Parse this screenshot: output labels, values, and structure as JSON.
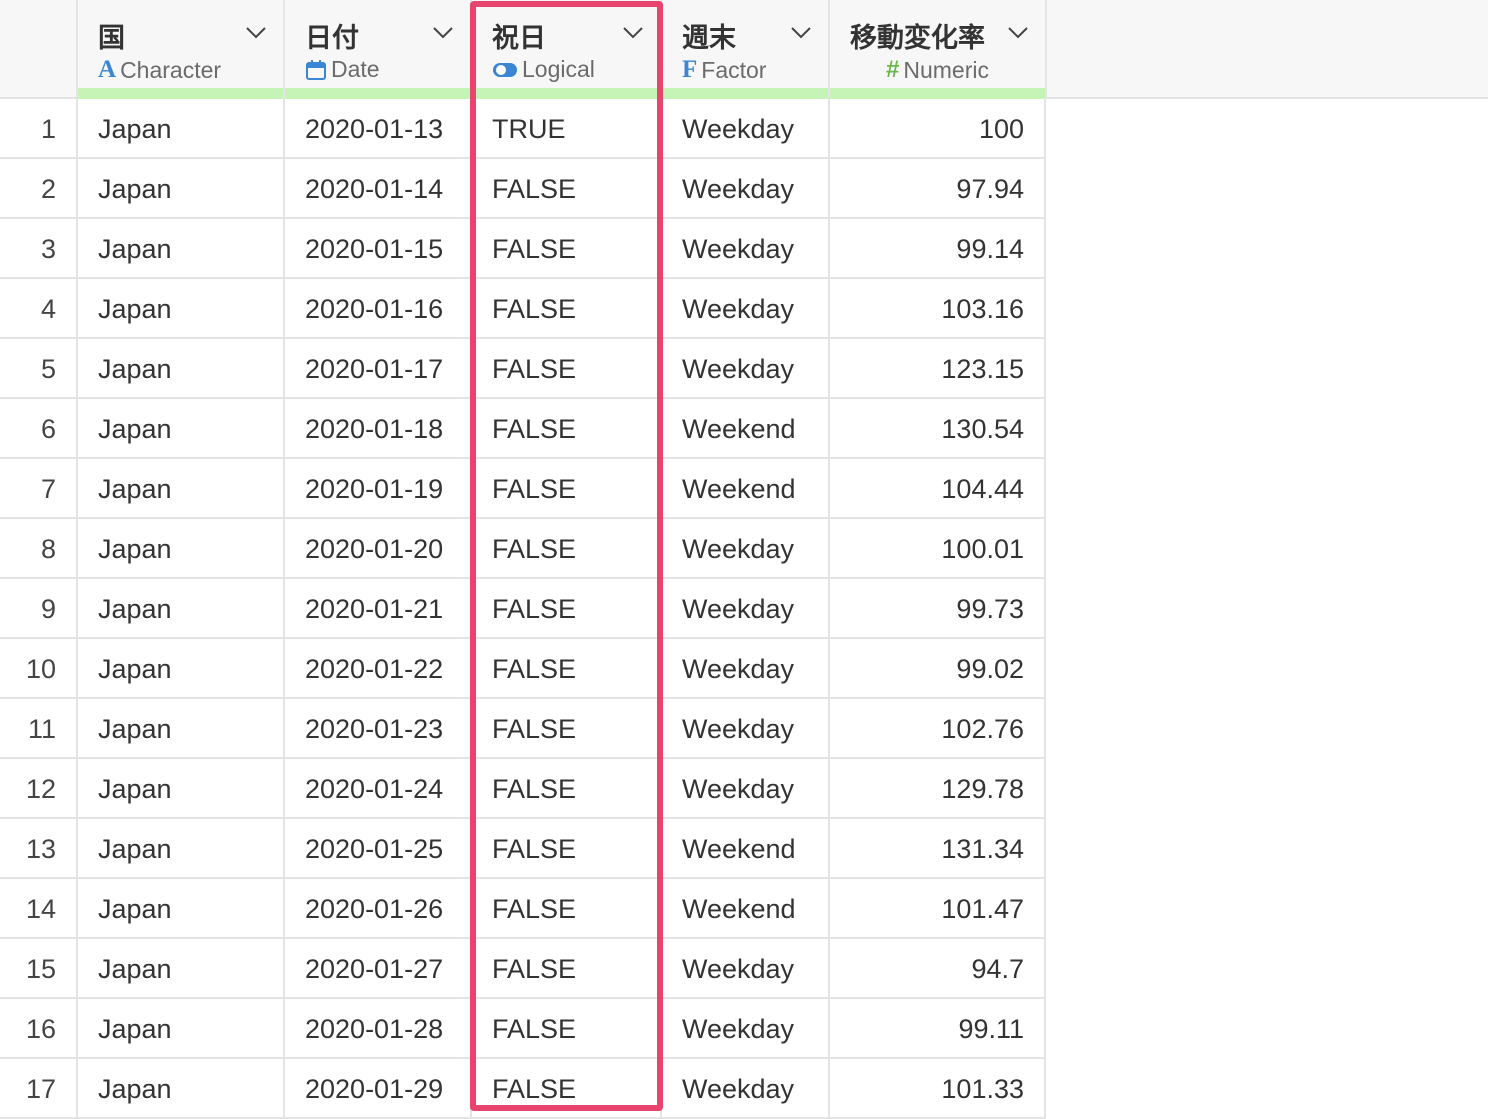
{
  "columns": [
    {
      "name": "国",
      "type_label": "Character",
      "type_icon": "character-type-icon"
    },
    {
      "name": "日付",
      "type_label": "Date",
      "type_icon": "calendar-icon"
    },
    {
      "name": "祝日",
      "type_label": "Logical",
      "type_icon": "toggle-icon"
    },
    {
      "name": "週末",
      "type_label": "Factor",
      "type_icon": "factor-type-icon"
    },
    {
      "name": "移動変化率",
      "type_label": "Numeric",
      "type_icon": "hash-icon"
    }
  ],
  "rows": [
    {
      "idx": "1",
      "country": "Japan",
      "date": "2020-01-13",
      "holiday": "TRUE",
      "weekend": "Weekday",
      "rate": "100"
    },
    {
      "idx": "2",
      "country": "Japan",
      "date": "2020-01-14",
      "holiday": "FALSE",
      "weekend": "Weekday",
      "rate": "97.94"
    },
    {
      "idx": "3",
      "country": "Japan",
      "date": "2020-01-15",
      "holiday": "FALSE",
      "weekend": "Weekday",
      "rate": "99.14"
    },
    {
      "idx": "4",
      "country": "Japan",
      "date": "2020-01-16",
      "holiday": "FALSE",
      "weekend": "Weekday",
      "rate": "103.16"
    },
    {
      "idx": "5",
      "country": "Japan",
      "date": "2020-01-17",
      "holiday": "FALSE",
      "weekend": "Weekday",
      "rate": "123.15"
    },
    {
      "idx": "6",
      "country": "Japan",
      "date": "2020-01-18",
      "holiday": "FALSE",
      "weekend": "Weekend",
      "rate": "130.54"
    },
    {
      "idx": "7",
      "country": "Japan",
      "date": "2020-01-19",
      "holiday": "FALSE",
      "weekend": "Weekend",
      "rate": "104.44"
    },
    {
      "idx": "8",
      "country": "Japan",
      "date": "2020-01-20",
      "holiday": "FALSE",
      "weekend": "Weekday",
      "rate": "100.01"
    },
    {
      "idx": "9",
      "country": "Japan",
      "date": "2020-01-21",
      "holiday": "FALSE",
      "weekend": "Weekday",
      "rate": "99.73"
    },
    {
      "idx": "10",
      "country": "Japan",
      "date": "2020-01-22",
      "holiday": "FALSE",
      "weekend": "Weekday",
      "rate": "99.02"
    },
    {
      "idx": "11",
      "country": "Japan",
      "date": "2020-01-23",
      "holiday": "FALSE",
      "weekend": "Weekday",
      "rate": "102.76"
    },
    {
      "idx": "12",
      "country": "Japan",
      "date": "2020-01-24",
      "holiday": "FALSE",
      "weekend": "Weekday",
      "rate": "129.78"
    },
    {
      "idx": "13",
      "country": "Japan",
      "date": "2020-01-25",
      "holiday": "FALSE",
      "weekend": "Weekend",
      "rate": "131.34"
    },
    {
      "idx": "14",
      "country": "Japan",
      "date": "2020-01-26",
      "holiday": "FALSE",
      "weekend": "Weekend",
      "rate": "101.47"
    },
    {
      "idx": "15",
      "country": "Japan",
      "date": "2020-01-27",
      "holiday": "FALSE",
      "weekend": "Weekday",
      "rate": "94.7"
    },
    {
      "idx": "16",
      "country": "Japan",
      "date": "2020-01-28",
      "holiday": "FALSE",
      "weekend": "Weekday",
      "rate": "99.11"
    },
    {
      "idx": "17",
      "country": "Japan",
      "date": "2020-01-29",
      "holiday": "FALSE",
      "weekend": "Weekday",
      "rate": "101.33"
    }
  ],
  "colors": {
    "highlight": "#e8446e",
    "quality_bar": "#c6f3b6",
    "character_icon": "#3a86d4",
    "date_icon": "#3a86d4",
    "logical_icon": "#3a86d4",
    "factor_icon": "#3a86d4",
    "numeric_icon": "#6cb84f"
  }
}
